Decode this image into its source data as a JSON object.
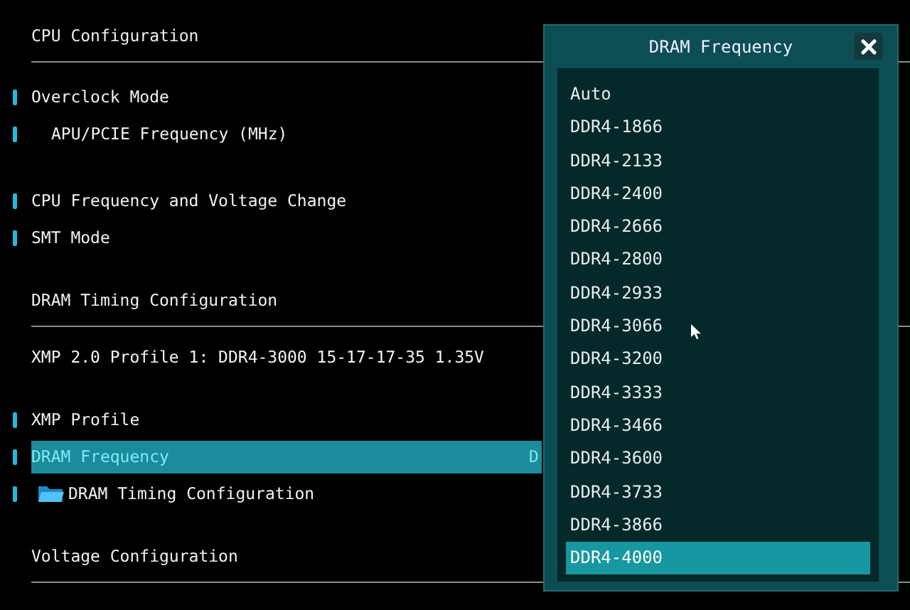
{
  "groups": [
    {
      "title": "CPU Configuration",
      "items": [
        {
          "kind": "item",
          "label": "Overclock Mode",
          "selected": false
        },
        {
          "kind": "subitem",
          "label": "APU/PCIE Frequency (MHz)",
          "selected": false
        }
      ]
    },
    {
      "items": [
        {
          "kind": "item",
          "label": "CPU Frequency and Voltage Change",
          "selected": false
        },
        {
          "kind": "item",
          "label": "SMT Mode",
          "selected": false
        }
      ]
    },
    {
      "title": "DRAM Timing Configuration",
      "info": "XMP 2.0 Profile 1: DDR4-3000 15-17-17-35 1.35V",
      "items": [
        {
          "kind": "item",
          "label": "XMP Profile",
          "selected": false
        },
        {
          "kind": "item",
          "label": "DRAM Frequency",
          "value": "D",
          "selected": true
        },
        {
          "kind": "folder",
          "label": "DRAM Timing Configuration",
          "selected": false
        }
      ]
    },
    {
      "title": "Voltage Configuration"
    }
  ],
  "dialog": {
    "title": "DRAM Frequency",
    "options": [
      {
        "label": "Auto",
        "selected": false
      },
      {
        "label": "DDR4-1866",
        "selected": false
      },
      {
        "label": "DDR4-2133",
        "selected": false
      },
      {
        "label": "DDR4-2400",
        "selected": false
      },
      {
        "label": "DDR4-2666",
        "selected": false
      },
      {
        "label": "DDR4-2800",
        "selected": false
      },
      {
        "label": "DDR4-2933",
        "selected": false
      },
      {
        "label": "DDR4-3066",
        "selected": false
      },
      {
        "label": "DDR4-3200",
        "selected": false
      },
      {
        "label": "DDR4-3333",
        "selected": false
      },
      {
        "label": "DDR4-3466",
        "selected": false
      },
      {
        "label": "DDR4-3600",
        "selected": false
      },
      {
        "label": "DDR4-3733",
        "selected": false
      },
      {
        "label": "DDR4-3866",
        "selected": false
      },
      {
        "label": "DDR4-4000",
        "selected": true
      }
    ]
  }
}
